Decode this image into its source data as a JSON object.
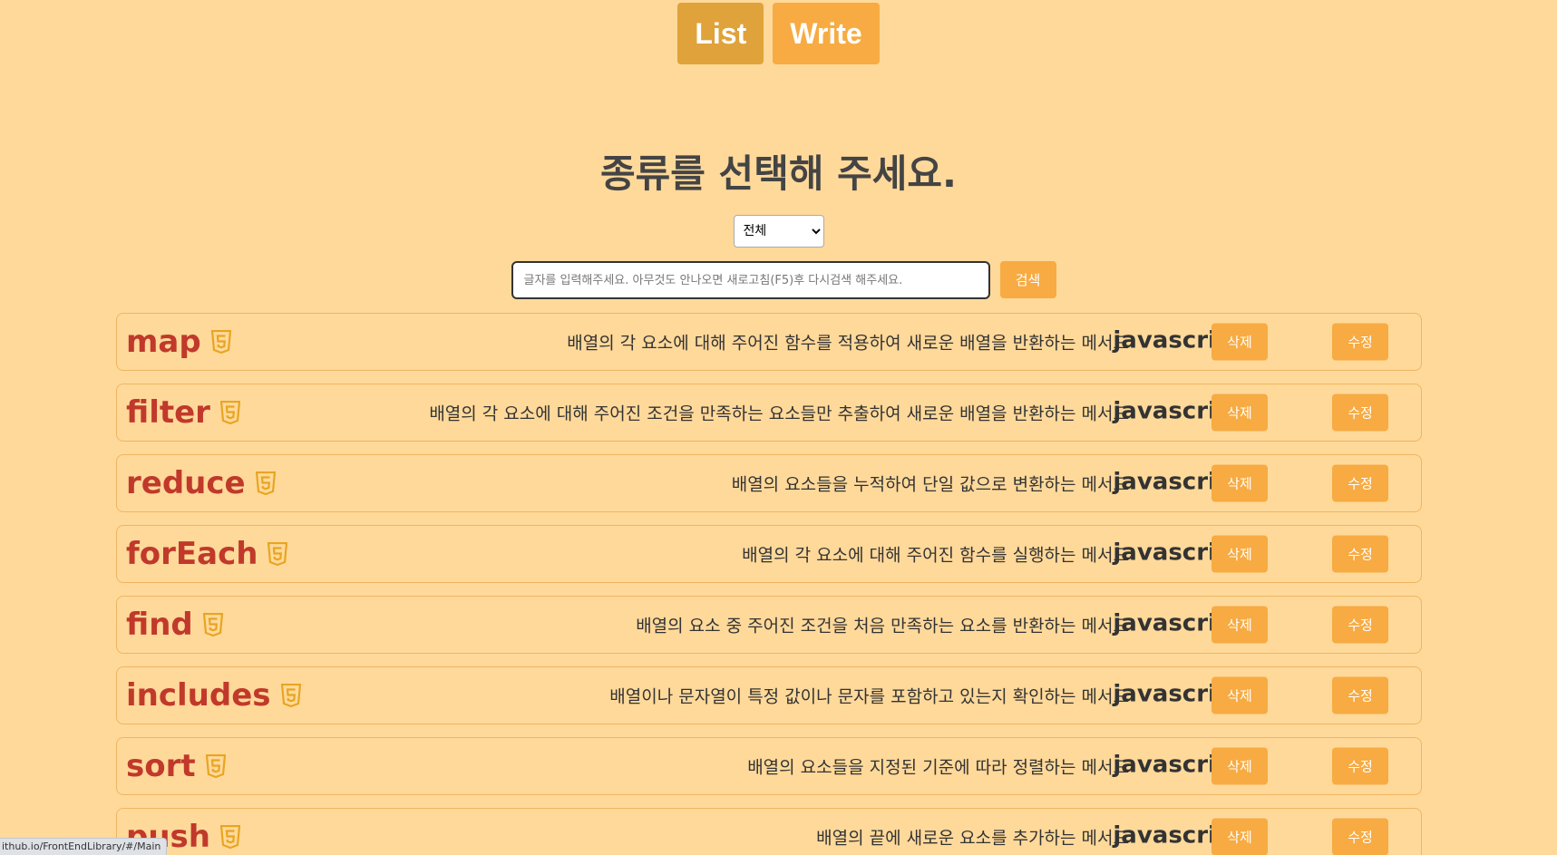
{
  "nav": {
    "list_label": "List",
    "write_label": "Write",
    "active": "List"
  },
  "heading": "종류를 선택해 주세요.",
  "filter": {
    "selected": "전체"
  },
  "search": {
    "placeholder": "글자를 입력해주세요. 아무것도 안나오면 새로고침(F5)후 다시검색 해주세요.",
    "button_label": "검색"
  },
  "row_buttons": {
    "delete_label": "삭제",
    "edit_label": "수정"
  },
  "items": [
    {
      "title": "map",
      "description": "배열의 각 요소에 대해 주어진 함수를 적용하여 새로운 배열을 반환하는 메서드",
      "language": "javascript",
      "icon": "html5-icon"
    },
    {
      "title": "filter",
      "description": "배열의 각 요소에 대해 주어진 조건을 만족하는 요소들만 추출하여 새로운 배열을 반환하는 메서드",
      "language": "javascript",
      "icon": "html5-icon"
    },
    {
      "title": "reduce",
      "description": "배열의 요소들을 누적하여 단일 값으로 변환하는 메서드",
      "language": "javascript",
      "icon": "html5-icon"
    },
    {
      "title": "forEach",
      "description": "배열의 각 요소에 대해 주어진 함수를 실행하는 메서드",
      "language": "javascript",
      "icon": "html5-icon"
    },
    {
      "title": "find",
      "description": "배열의 요소 중 주어진 조건을 처음 만족하는 요소를 반환하는 메서드",
      "language": "javascript",
      "icon": "html5-icon"
    },
    {
      "title": "includes",
      "description": "배열이나 문자열이 특정 값이나 문자를 포함하고 있는지 확인하는 메서드",
      "language": "javascript",
      "icon": "html5-icon"
    },
    {
      "title": "sort",
      "description": "배열의 요소들을 지정된 기준에 따라 정렬하는 메서드",
      "language": "javascript",
      "icon": "html5-icon"
    },
    {
      "title": "push",
      "description": "배열의 끝에 새로운 요소를 추가하는 메서드",
      "language": "javascript",
      "icon": "html5-icon"
    }
  ],
  "status_bar": "ithub.io/FrontEndLibrary/#/Main",
  "colors": {
    "background": "#ffd99a",
    "accent": "#f7ab42",
    "accent_active": "#e0a23a",
    "title_red": "#c0392b",
    "icon_gold": "#e8a521"
  }
}
